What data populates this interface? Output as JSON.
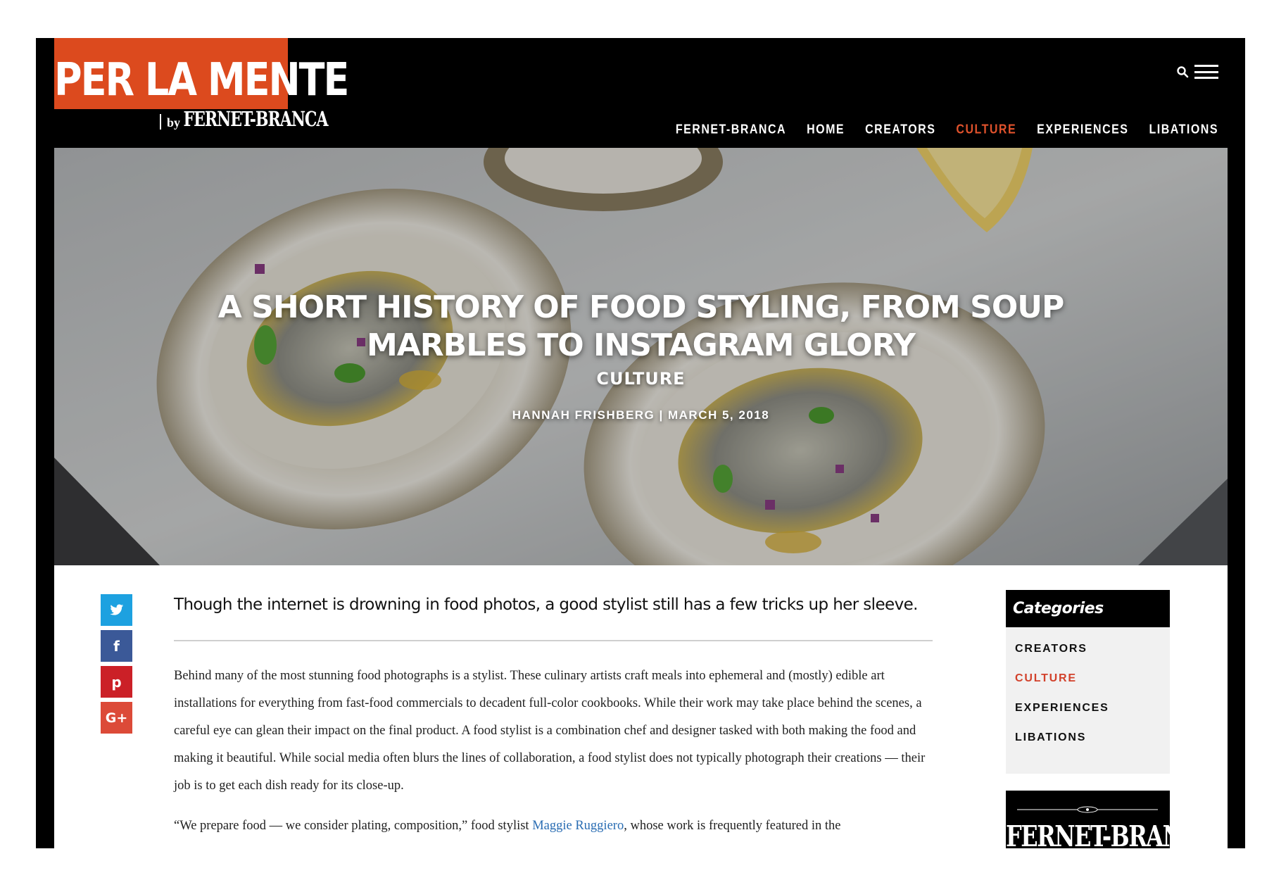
{
  "site": {
    "logo_text": "PER LA MENTE",
    "logo_by": "by",
    "logo_brand": "FERNET-BRANCA"
  },
  "nav": {
    "items": [
      "FERNET-BRANCA",
      "HOME",
      "CREATORS",
      "CULTURE",
      "EXPERIENCES",
      "LIBATIONS"
    ],
    "active": "CULTURE"
  },
  "header_icons": [
    "search-icon",
    "hamburger-menu-icon"
  ],
  "hero": {
    "title": "A SHORT HISTORY OF FOOD STYLING, FROM SOUP MARBLES TO INSTAGRAM GLORY",
    "category": "CULTURE",
    "meta": "HANNAH FRISHBERG | MARCH 5, 2018"
  },
  "share": [
    {
      "name": "twitter",
      "icon": "twitter-icon",
      "color": "#1da1e0"
    },
    {
      "name": "facebook",
      "icon": "facebook-icon",
      "color": "#3b5998"
    },
    {
      "name": "pinterest",
      "icon": "pinterest-icon",
      "color": "#cb2027"
    },
    {
      "name": "google-plus",
      "icon": "google-plus-icon",
      "color": "#dc4a38"
    }
  ],
  "article": {
    "deck": "Though the internet is drowning in food photos, a good stylist still has a few tricks up her sleeve.",
    "paragraph1": "Behind many of the most stunning food photographs is a stylist. These culinary artists craft meals into ephemeral and (mostly) edible art installations for everything from fast-food commercials to decadent full-color cookbooks. While their work may take place behind the scenes, a careful eye can glean their impact on the final product. A food stylist is a combination chef and designer tasked with both making the food and making it beautiful. While social media often blurs the lines of collaboration, a food stylist does not typically photograph their creations — their job is to get each dish ready for its close-up.",
    "paragraph2_a": "“We prepare food — we consider plating, composition,” food stylist ",
    "paragraph2_link": "Maggie Ruggiero",
    "paragraph2_b": ", whose work is frequently featured in the"
  },
  "sidebar": {
    "categories_title": "Categories",
    "categories": [
      "CREATORS",
      "CULTURE",
      "EXPERIENCES",
      "LIBATIONS"
    ],
    "active_category": "CULTURE",
    "brand_name": "FERNET-BRANCA"
  },
  "colors": {
    "brand_orange": "#dc4a1e",
    "active_nav": "#e0522c",
    "link": "#2a6db3"
  }
}
